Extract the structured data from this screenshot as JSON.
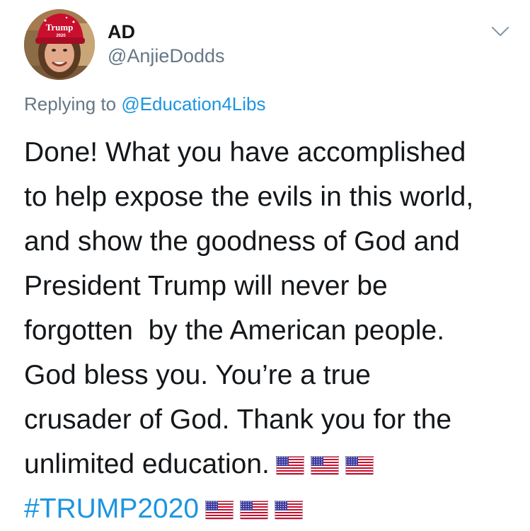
{
  "tweet": {
    "display_name": "AD",
    "handle": "@AnjieDodds",
    "replying_to_label": "Replying to",
    "replying_to_handle": "@Education4Libs",
    "body_lines": [
      "Done! What you have accomplished",
      "to help expose the evils in this world,",
      "and show the goodness of God and",
      "President Trump will never be",
      "forgotten  by the American people.",
      "God bless you. You’re a true",
      "crusader of God. Thank you for the",
      "unlimited education."
    ],
    "hashtag": "#TRUMP2020",
    "avatar_hat_text": "Trump",
    "avatar_hat_year": "2020",
    "flag_emoji": "us-flag-icon",
    "colors": {
      "text": "#14171a",
      "secondary": "#657786",
      "link": "#1b95e0",
      "flag_red": "#c8102e",
      "flag_blue": "#3c3b9e"
    }
  }
}
